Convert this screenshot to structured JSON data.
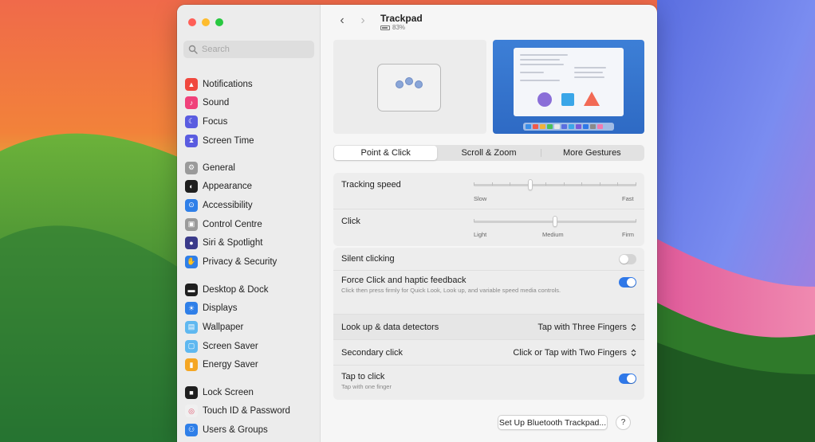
{
  "window": {
    "title": "Trackpad",
    "battery_text": "83%"
  },
  "sidebar": {
    "search_placeholder": "Search",
    "groups": [
      [
        {
          "label": "Notifications",
          "icon": "bell-icon",
          "color": "#f0483e"
        },
        {
          "label": "Sound",
          "icon": "speaker-icon",
          "color": "#f0417a"
        },
        {
          "label": "Focus",
          "icon": "moon-icon",
          "color": "#5a5ce0"
        },
        {
          "label": "Screen Time",
          "icon": "hourglass-icon",
          "color": "#5a5ce0"
        }
      ],
      [
        {
          "label": "General",
          "icon": "gear-icon",
          "color": "#9a9a9a"
        },
        {
          "label": "Appearance",
          "icon": "appearance-icon",
          "color": "#1f1f1f"
        },
        {
          "label": "Accessibility",
          "icon": "accessibility-icon",
          "color": "#2f7fe8"
        },
        {
          "label": "Control Centre",
          "icon": "control-centre-icon",
          "color": "#9a9a9a"
        },
        {
          "label": "Siri & Spotlight",
          "icon": "siri-icon",
          "color": "#3a3a8a"
        },
        {
          "label": "Privacy & Security",
          "icon": "hand-icon",
          "color": "#2f7fe8"
        }
      ],
      [
        {
          "label": "Desktop & Dock",
          "icon": "dock-icon",
          "color": "#1f1f1f"
        },
        {
          "label": "Displays",
          "icon": "sun-icon",
          "color": "#2f7fe8"
        },
        {
          "label": "Wallpaper",
          "icon": "wallpaper-icon",
          "color": "#5fb8f0"
        },
        {
          "label": "Screen Saver",
          "icon": "screensaver-icon",
          "color": "#5fb8f0"
        },
        {
          "label": "Energy Saver",
          "icon": "battery-icon",
          "color": "#f5a623"
        }
      ],
      [
        {
          "label": "Lock Screen",
          "icon": "lock-icon",
          "color": "#1f1f1f"
        },
        {
          "label": "Touch ID & Password",
          "icon": "fingerprint-icon",
          "color": "#f0f0f0"
        },
        {
          "label": "Users & Groups",
          "icon": "users-icon",
          "color": "#2f7fe8"
        }
      ]
    ]
  },
  "tabs": [
    {
      "label": "Point & Click",
      "active": true
    },
    {
      "label": "Scroll & Zoom",
      "active": false
    },
    {
      "label": "More Gestures",
      "active": false
    }
  ],
  "settings": {
    "tracking_speed": {
      "label": "Tracking speed",
      "min_label": "Slow",
      "max_label": "Fast",
      "value": 0.35
    },
    "click": {
      "label": "Click",
      "labels": [
        "Light",
        "Medium",
        "Firm"
      ],
      "value": 0.5
    },
    "silent_clicking": {
      "label": "Silent clicking",
      "on": false
    },
    "force_click": {
      "label": "Force Click and haptic feedback",
      "description": "Click then press firmly for Quick Look, Look up, and variable speed media controls.",
      "on": true
    },
    "look_up": {
      "label": "Look up & data detectors",
      "value": "Tap with Three Fingers"
    },
    "secondary_click": {
      "label": "Secondary click",
      "value": "Click or Tap with Two Fingers"
    },
    "tap_to_click": {
      "label": "Tap to click",
      "description": "Tap with one finger",
      "on": true
    }
  },
  "footer": {
    "bluetooth_button": "Set Up Bluetooth Trackpad...",
    "help_label": "?"
  },
  "colors": {
    "accent": "#2f78e8"
  }
}
